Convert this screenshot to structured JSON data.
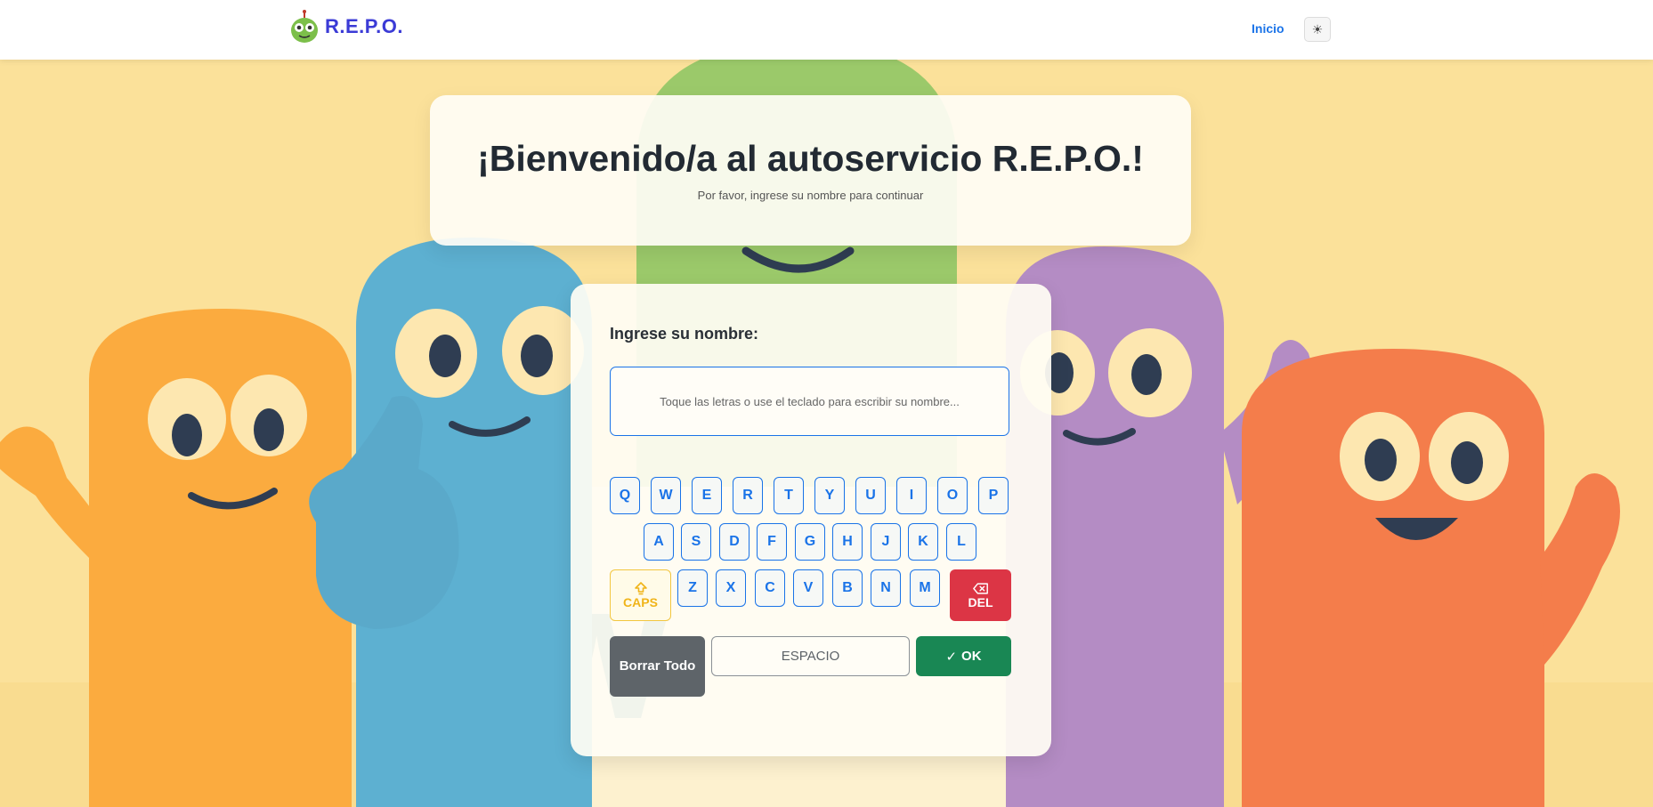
{
  "navbar": {
    "brand": "R.E.P.O.",
    "links": [
      {
        "label": "Inicio"
      }
    ],
    "theme_toggle_icon": "sun-icon",
    "theme_toggle_glyph": "☀"
  },
  "welcome": {
    "title": "¡Bienvenido/a al autoservicio R.E.P.O.!",
    "subtitle": "Por favor, ingrese su nombre para continuar"
  },
  "form": {
    "label": "Ingrese su nombre:",
    "input_value": "",
    "input_placeholder": "Toque las letras o use el teclado para escribir su nombre..."
  },
  "keyboard": {
    "row1": [
      "Q",
      "W",
      "E",
      "R",
      "T",
      "Y",
      "U",
      "I",
      "O",
      "P"
    ],
    "row2": [
      "A",
      "S",
      "D",
      "F",
      "G",
      "H",
      "J",
      "K",
      "L"
    ],
    "row3": [
      "Z",
      "X",
      "C",
      "V",
      "B",
      "N",
      "M"
    ],
    "caps_label": "CAPS",
    "del_label": "DEL",
    "clear_label": "Borrar Todo",
    "space_label": "ESPACIO",
    "ok_label": "OK",
    "ok_glyph": "✓"
  },
  "colors": {
    "brand": "#3b3bd6",
    "accent": "#1a73e8",
    "caps": "#f0b419",
    "delete": "#dc3545",
    "clear": "#5e6469",
    "ok": "#198754"
  }
}
